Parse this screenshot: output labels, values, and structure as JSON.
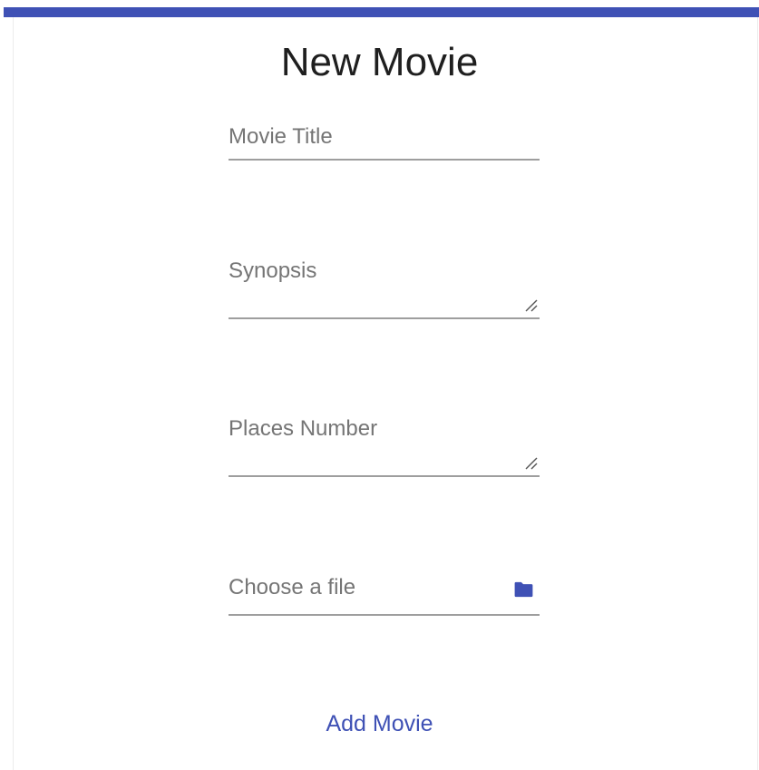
{
  "header": {
    "title": "New Movie",
    "accent_color": "#3f51b5"
  },
  "form": {
    "movie_title": {
      "label": "Movie Title",
      "value": ""
    },
    "synopsis": {
      "label": "Synopsis",
      "value": ""
    },
    "places_number": {
      "label": "Places Number",
      "value": ""
    },
    "file": {
      "label": "Choose a file",
      "icon": "folder-icon"
    },
    "submit_label": "Add Movie"
  }
}
